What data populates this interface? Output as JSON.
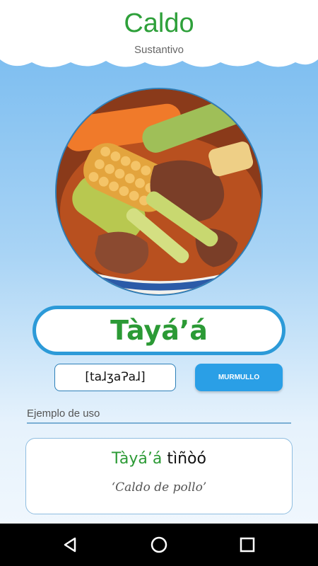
{
  "header": {
    "title": "Caldo",
    "subtitle": "Sustantivo"
  },
  "entry": {
    "word": "Tàyá’á",
    "ipa": "[taɺʒaɁaɺ]",
    "audio_button": "MURMULLO"
  },
  "example": {
    "label": "Ejemplo de uso",
    "highlight": "Tàyá’á",
    "rest": " tìñòó",
    "translation": "‘Caldo de pollo’"
  },
  "navbar": {
    "icons": [
      "back-icon",
      "home-icon",
      "recents-icon"
    ]
  },
  "colors": {
    "accent_green": "#2b9a35",
    "accent_blue": "#2a9fe6",
    "border_blue": "#2c9ad8"
  }
}
